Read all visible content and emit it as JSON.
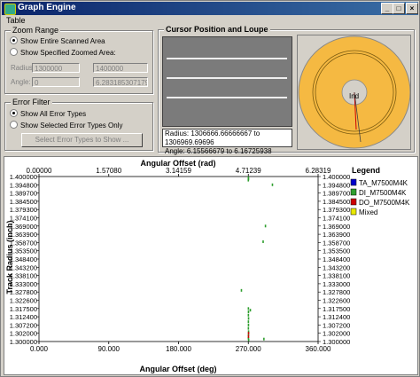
{
  "window": {
    "title": "Graph Engine",
    "controls": [
      "_",
      "□",
      "×"
    ]
  },
  "menu": {
    "items": [
      "Table"
    ]
  },
  "zoom_range": {
    "label": "Zoom Range",
    "option_entire": "Show Entire Scanned Area",
    "option_zoomed": "Show Specified Zoomed Area:",
    "selected": "Show Entire Scanned Area",
    "radius_label": "Radius",
    "radius_from": "1300000",
    "radius_to": "1400000",
    "angle_label": "Angle:",
    "angle_from": "0",
    "angle_to": "6.28318530717958"
  },
  "error_filter": {
    "label": "Error Filter",
    "option_all": "Show All Error Types",
    "option_selected": "Show Selected Error Types Only",
    "selected": "Show All Error Types",
    "select_button": "Select Error Types to Show ..."
  },
  "cursor": {
    "label": "Cursor Position and Loupe",
    "radius_line": "Radius:  1306666.66666667 to 1306969.69696",
    "angle_line": "Angle:    6.15566679           to  6.16725938",
    "loupe_label": "Ind"
  },
  "colors": {
    "title_start": "#0a246a",
    "title_end": "#3a6ea5",
    "disk": "#f5b942",
    "ta": "#0000cc",
    "di": "#2e9e2e",
    "do": "#cc0000",
    "mixed": "#e8e800"
  },
  "chart_data": {
    "type": "scatter",
    "xlabel_bottom": "Angular Offset (deg)",
    "xlabel_top": "Angular Offset (rad)",
    "ylabel": "Track Radius (inch)",
    "xlim": [
      0,
      360
    ],
    "ylim": [
      1.3,
      1.4
    ],
    "x_ticks_bottom": [
      "0.000",
      "90.000",
      "180.000",
      "270.000",
      "360.000"
    ],
    "x_ticks_top": [
      "0.00000",
      "1.57080",
      "3.14159",
      "4.71239",
      "6.28319"
    ],
    "y_ticks": [
      "1.400000",
      "1.394800",
      "1.389700",
      "1.384500",
      "1.379300",
      "1.374100",
      "1.369000",
      "1.363900",
      "1.358700",
      "1.353500",
      "1.348400",
      "1.343200",
      "1.338100",
      "1.333000",
      "1.327800",
      "1.322600",
      "1.317500",
      "1.312400",
      "1.307200",
      "1.302000",
      "1.300000"
    ],
    "legend_title": "Legend",
    "legend": [
      {
        "name": "TA_M7500M4K",
        "color": "#0000cc"
      },
      {
        "name": "DI_M7500M4K",
        "color": "#2e9e2e"
      },
      {
        "name": "DO_M7500M4K",
        "color": "#cc0000"
      },
      {
        "name": "Mixed",
        "color": "#e8e800"
      }
    ],
    "series": [
      {
        "name": "DI_M7500M4K",
        "points": [
          [
            270.0,
            1.3993
          ],
          [
            270.1,
            1.3985
          ],
          [
            269.9,
            1.3978
          ],
          [
            270.0,
            1.32
          ],
          [
            270.1,
            1.318
          ],
          [
            270.0,
            1.316
          ],
          [
            270.2,
            1.314
          ],
          [
            270.0,
            1.312
          ],
          [
            270.1,
            1.31
          ],
          [
            270.0,
            1.308
          ],
          [
            270.2,
            1.306
          ],
          [
            270.1,
            1.304
          ],
          [
            270.0,
            1.302
          ],
          [
            270.3,
            1.301
          ],
          [
            261.0,
            1.331
          ],
          [
            272.5,
            1.319
          ],
          [
            292.0,
            1.37
          ],
          [
            289.0,
            1.3605
          ],
          [
            290.0,
            1.3015
          ],
          [
            301.0,
            1.395
          ]
        ]
      },
      {
        "name": "DO_M7500M4K",
        "points": [
          [
            270.2,
            1.305
          ],
          [
            270.1,
            1.303
          ]
        ]
      }
    ]
  }
}
